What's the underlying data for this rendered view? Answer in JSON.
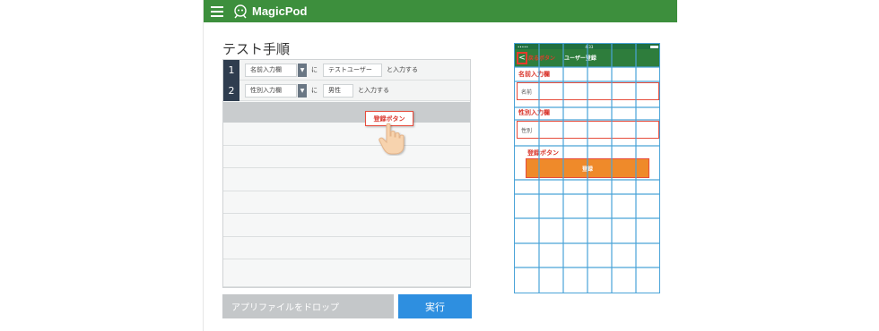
{
  "header": {
    "brand": "MagicPod"
  },
  "steps": {
    "title": "テスト手順",
    "rows": [
      {
        "number": "1",
        "element": "名前入力欄",
        "particle": "に",
        "value": "テストユーザー",
        "action": "と入力する"
      },
      {
        "number": "2",
        "element": "性別入力欄",
        "particle": "に",
        "value": "男性",
        "action": "と入力する"
      }
    ],
    "dropdown_glyph": "▼",
    "dragged_chip": "登録ボタン"
  },
  "footer": {
    "drop_placeholder": "アプリファイルをドロップ",
    "run_label": "実行"
  },
  "phone": {
    "status_left": "•••••",
    "status_time": "4:33",
    "back_glyph": "<",
    "back_text": "戻るボタン",
    "nav_title": "ユーザー登録",
    "name_label": "名前入力欄",
    "name_placeholder": "名前",
    "gender_label": "性別入力欄",
    "gender_placeholder": "性別",
    "button_label_overlay": "登録ボタン",
    "button_text": "登録"
  },
  "colors": {
    "header": "#3d8f3d",
    "run": "#2e8fe0",
    "highlight": "#e64c3c",
    "phone_button": "#ef8a2a",
    "grid": "#4aa3d8"
  }
}
